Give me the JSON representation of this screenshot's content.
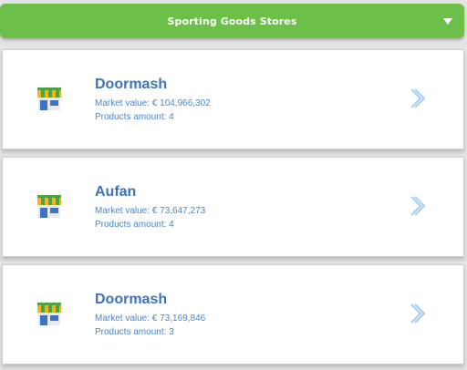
{
  "header": {
    "title": "Sporting Goods Stores"
  },
  "stores": [
    {
      "name": "Doormash",
      "market_value": "Market value: € 104,966,302",
      "products_amount": "Products amount: 4"
    },
    {
      "name": "Aufan",
      "market_value": "Market value: € 73,647,273",
      "products_amount": "Products amount: 4"
    },
    {
      "name": "Doormash",
      "market_value": "Market value: € 73,169,846",
      "products_amount": "Products amount: 3"
    }
  ],
  "icons": {
    "store": "storefront-icon",
    "chevron": "chevron-right-icon",
    "dropdown": "caret-down-icon"
  },
  "colors": {
    "header": "#6cc04a",
    "store_name": "#3f73b4",
    "meta_text": "#4a86c8",
    "chevron": "#a9d0f0"
  }
}
